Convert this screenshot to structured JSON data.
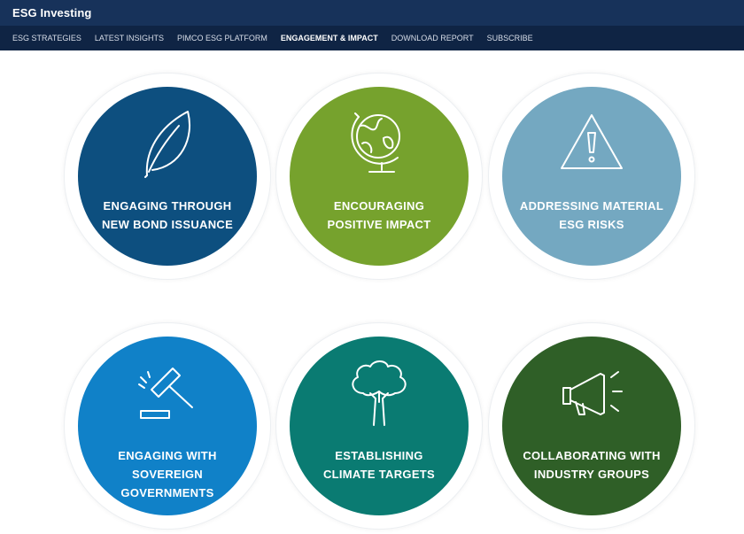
{
  "header": {
    "title": "ESG Investing"
  },
  "nav": [
    {
      "label": "ESG STRATEGIES",
      "active": false
    },
    {
      "label": "LATEST INSIGHTS",
      "active": false
    },
    {
      "label": "PIMCO ESG PLATFORM",
      "active": false
    },
    {
      "label": "ENGAGEMENT & IMPACT",
      "active": true
    },
    {
      "label": "DOWNLOAD REPORT",
      "active": false
    },
    {
      "label": "SUBSCRIBE",
      "active": false
    }
  ],
  "tiles": [
    {
      "lines": [
        "ENGAGING THROUGH",
        "NEW BOND ISSUANCE"
      ],
      "color": "#0d4f7f",
      "icon": "leaf-icon"
    },
    {
      "lines": [
        "ENCOURAGING",
        "POSITIVE IMPACT"
      ],
      "color": "#76a22d",
      "icon": "globe-icon"
    },
    {
      "lines": [
        "ADDRESSING MATERIAL",
        "ESG RISKS"
      ],
      "color": "#74a8c1",
      "icon": "warning-icon"
    },
    {
      "lines": [
        "ENGAGING WITH",
        "SOVEREIGN",
        "GOVERNMENTS"
      ],
      "color": "#1081c8",
      "icon": "gavel-icon"
    },
    {
      "lines": [
        "ESTABLISHING",
        "CLIMATE TARGETS"
      ],
      "color": "#0a7b72",
      "icon": "tree-icon"
    },
    {
      "lines": [
        "COLLABORATING WITH",
        "INDUSTRY GROUPS"
      ],
      "color": "#2f5f27",
      "icon": "megaphone-icon"
    }
  ]
}
